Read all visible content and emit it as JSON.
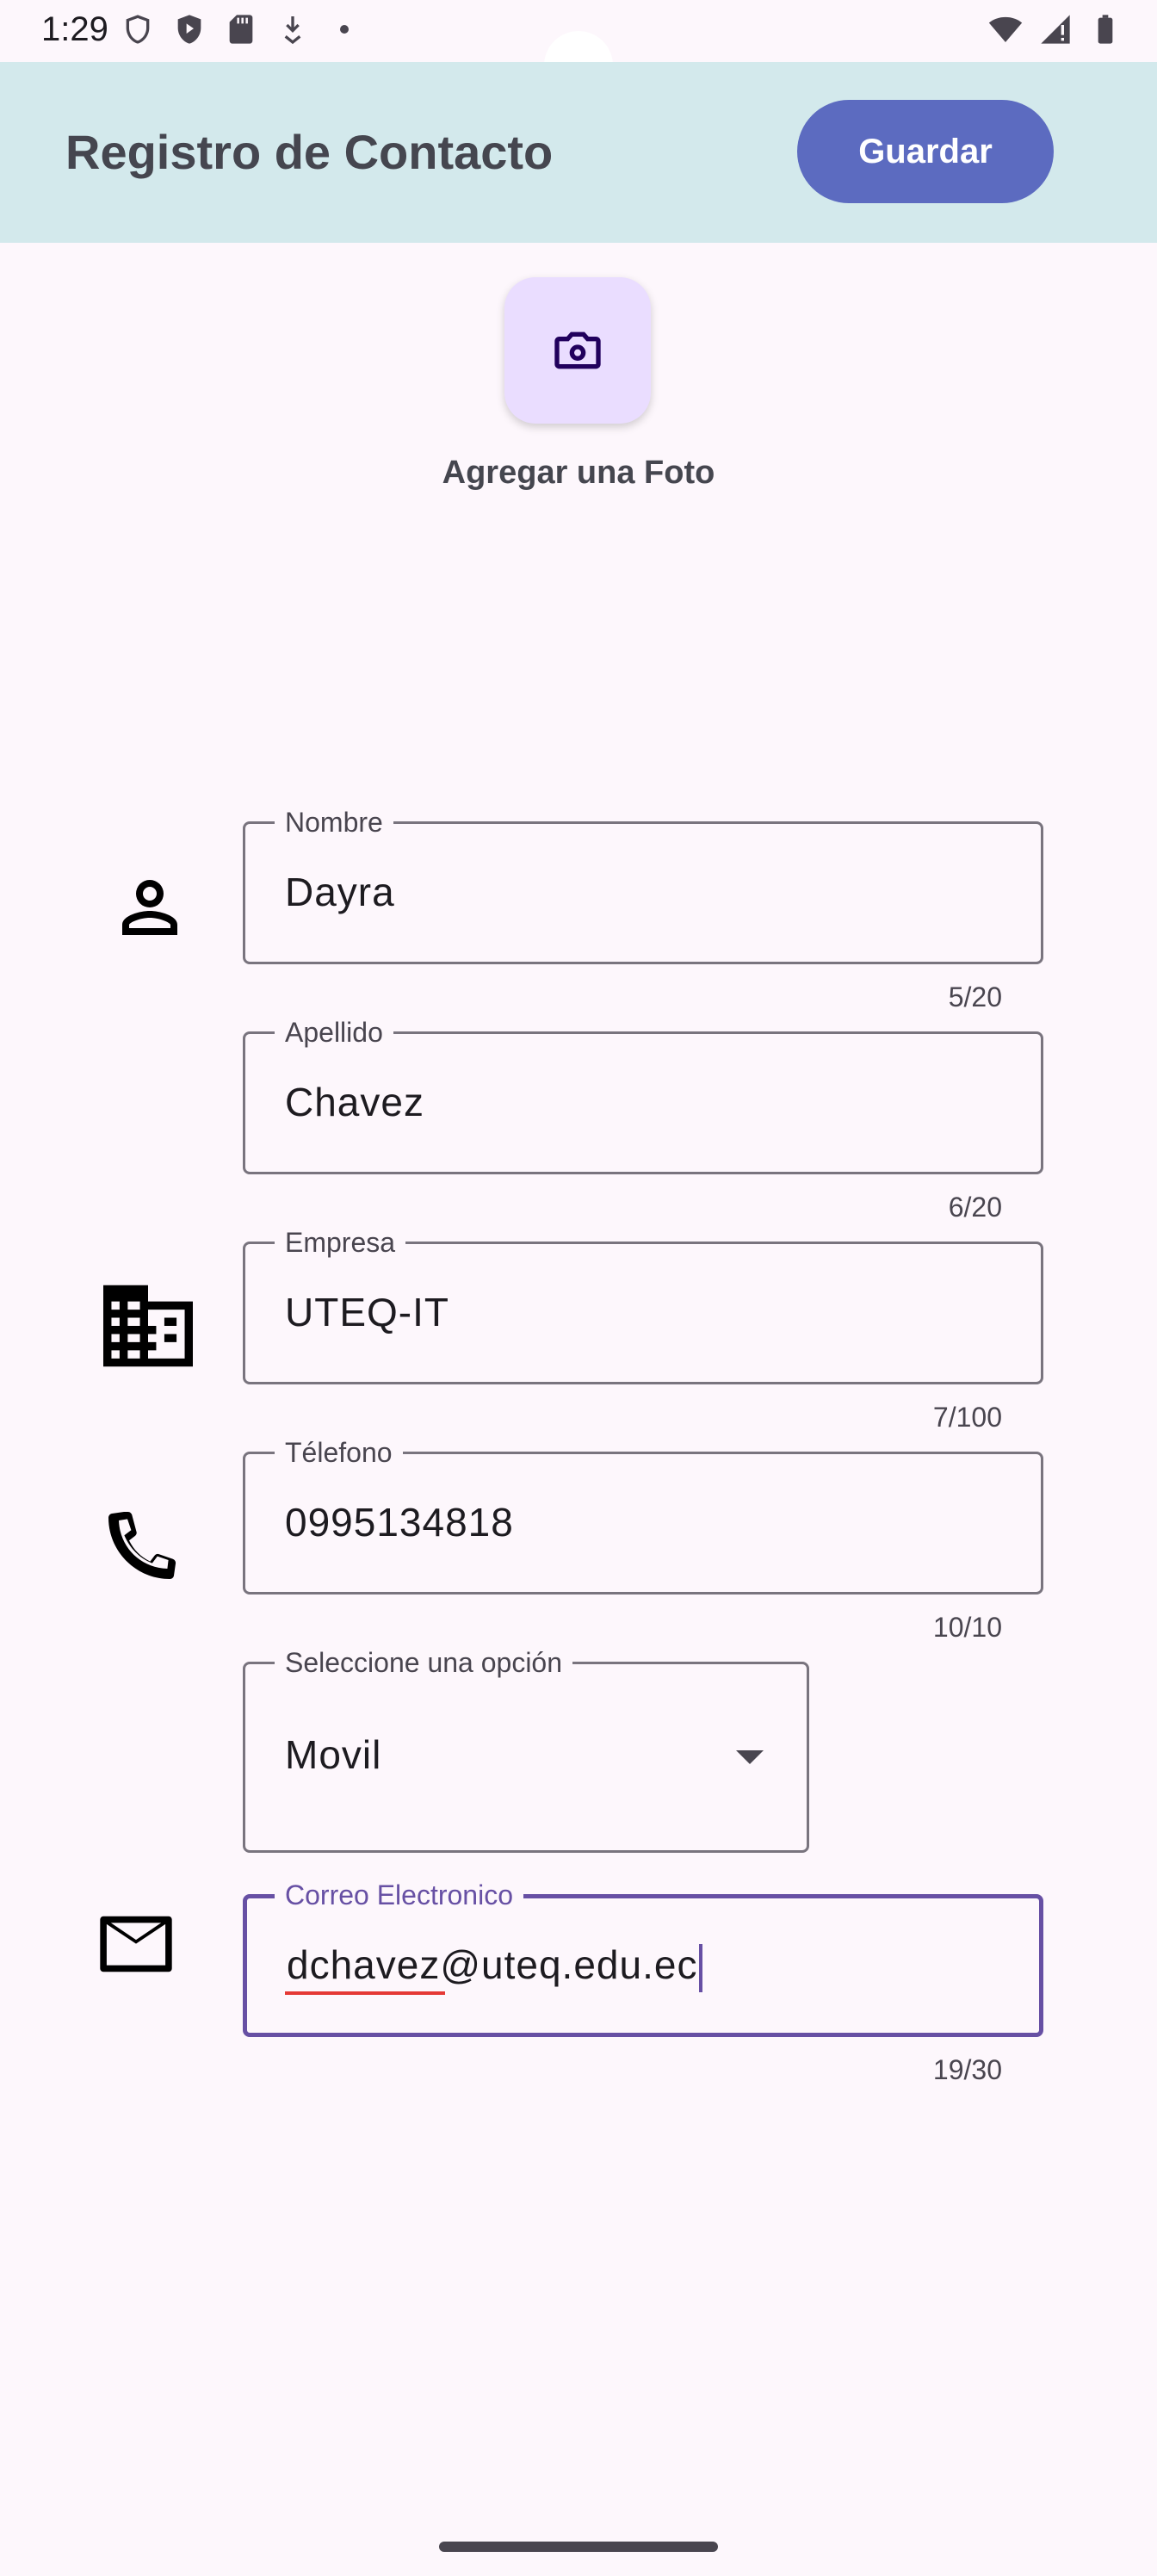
{
  "status_bar": {
    "time": "1:29"
  },
  "app_bar": {
    "title": "Registro de Contacto",
    "save_label": "Guardar"
  },
  "photo": {
    "label": "Agregar una Foto"
  },
  "form": {
    "nombre": {
      "label": "Nombre",
      "value": "Dayra",
      "counter": "5/20"
    },
    "apellido": {
      "label": "Apellido",
      "value": "Chavez",
      "counter": "6/20"
    },
    "empresa": {
      "label": "Empresa",
      "value": "UTEQ-IT",
      "counter": "7/100"
    },
    "telefono": {
      "label": "Télefono",
      "value": "0995134818",
      "counter": "10/10"
    },
    "tipo": {
      "label": "Seleccione una opción",
      "value": "Movil"
    },
    "correo": {
      "label": "Correo Electronico",
      "value": "dchavez@uteq.edu.ec",
      "counter": "19/30"
    }
  },
  "colors": {
    "app_bar_bg": "#d3e9ec",
    "primary_button": "#5c6bc0",
    "focus": "#6750a4",
    "background": "#fdf7fc"
  }
}
